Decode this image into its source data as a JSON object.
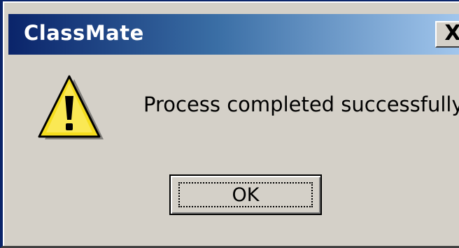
{
  "dialog": {
    "title": "ClassMate",
    "close_glyph": "X",
    "message": "Process completed successfully.",
    "ok_label": "OK",
    "icon": "warning-icon"
  },
  "colors": {
    "titlebar_start": "#0a246a",
    "titlebar_end": "#a6caf0",
    "dialog_face": "#d4d0c8",
    "icon_yellow": "#f5dd1e"
  }
}
